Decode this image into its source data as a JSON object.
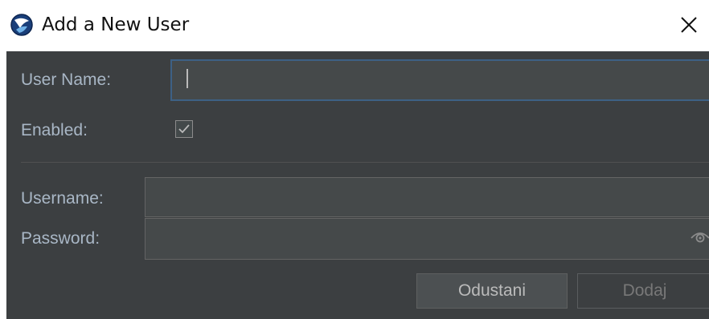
{
  "window": {
    "title": "Add a New User",
    "icon": "app-logo-icon",
    "close_icon": "close-icon"
  },
  "form": {
    "user_name_label": "User Name:",
    "user_name_value": "",
    "enabled_label": "Enabled:",
    "enabled_checked": true,
    "username_label": "Username:",
    "username_value": "",
    "password_label": "Password:",
    "password_value": "",
    "password_toggle_icon": "eye-icon"
  },
  "buttons": {
    "cancel_label": "Odustani",
    "add_label": "Dodaj",
    "add_enabled": false
  },
  "colors": {
    "dialog_background": "#3c3f41",
    "label_text": "#a9b7c6",
    "focus_border": "#3d6185",
    "field_background": "#45494a"
  }
}
